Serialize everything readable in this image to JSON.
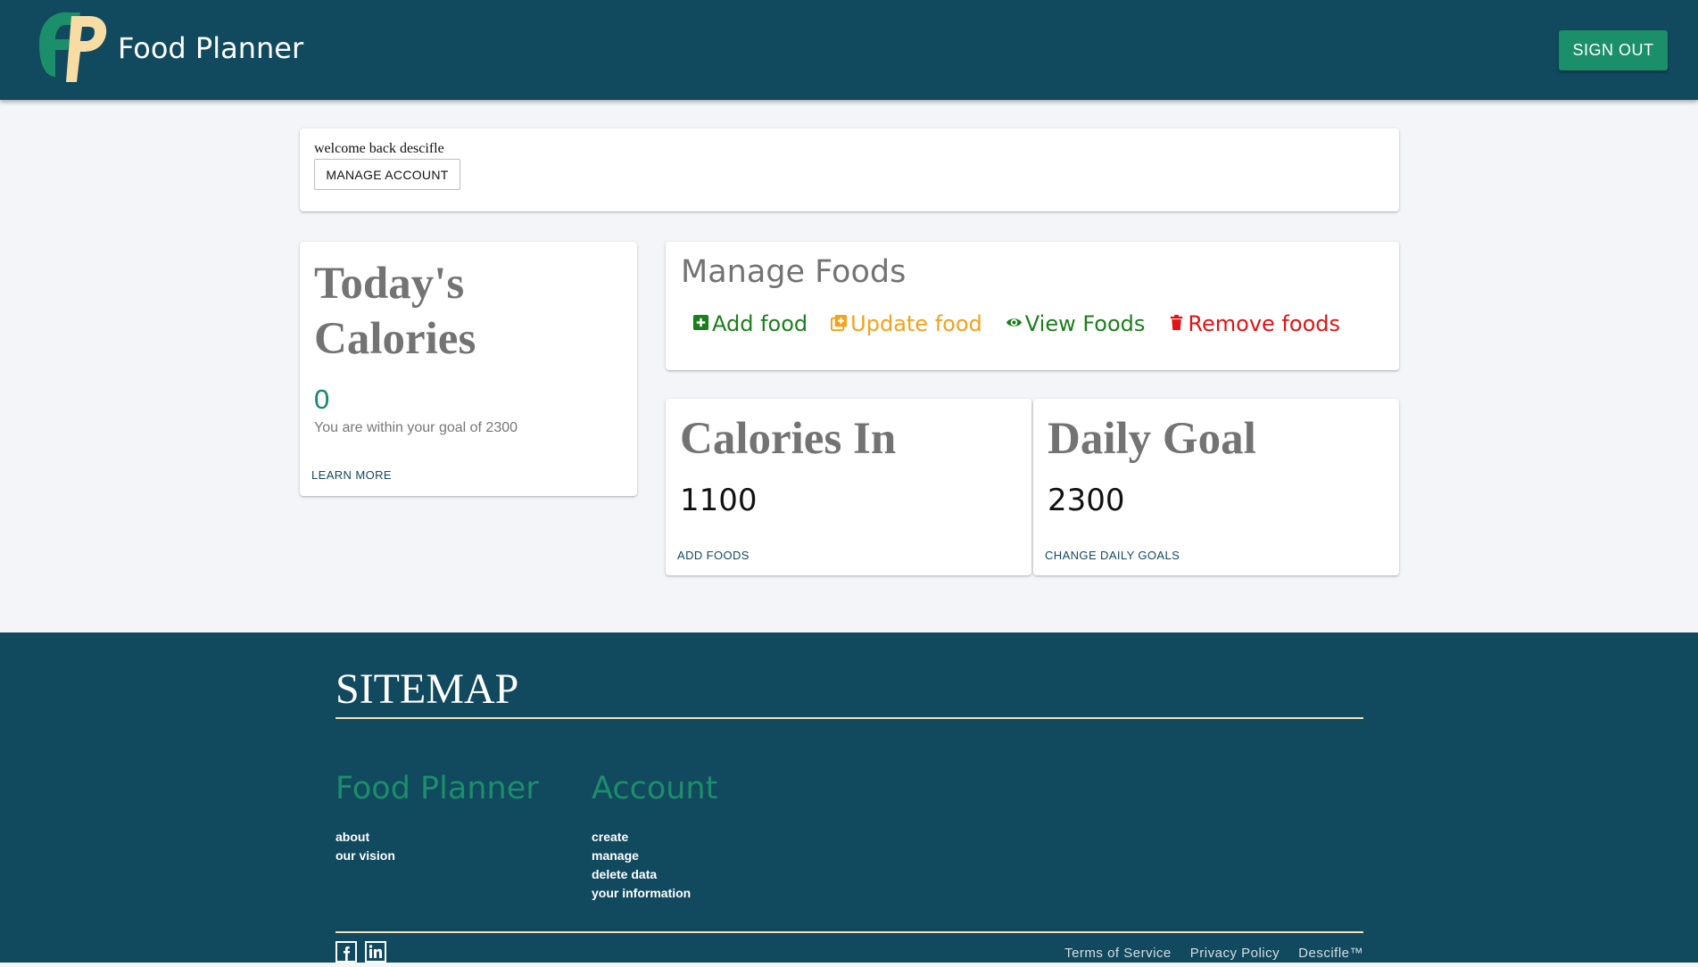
{
  "header": {
    "brand": "Food Planner",
    "sign_out_label": "SIGN OUT",
    "logo_icon": "fp-logo",
    "colors": {
      "bar": "#11495f",
      "accent": "#1b8e6a",
      "logo_cream": "#f7dca4"
    }
  },
  "welcome": {
    "text": "welcome back descifle",
    "manage_account_label": "MANAGE ACCOUNT"
  },
  "today": {
    "title": "Today's Calories",
    "value": "0",
    "subtitle": "You are within your goal of 2300",
    "link": "LEARN MORE"
  },
  "manage_foods": {
    "title": "Manage Foods",
    "actions": [
      {
        "label": "Add food",
        "icon": "plus-square-icon",
        "color": "#1a7f1a"
      },
      {
        "label": "Update food",
        "icon": "copy-plus-icon",
        "color": "#f2a21b"
      },
      {
        "label": "View Foods",
        "icon": "eye-icon",
        "color": "#1a7f1a"
      },
      {
        "label": "Remove foods",
        "icon": "trash-icon",
        "color": "#e31313"
      }
    ]
  },
  "calories_in": {
    "title": "Calories In",
    "value": "1100",
    "link": "ADD FOODS"
  },
  "daily_goal": {
    "title": "Daily Goal",
    "value": "2300",
    "link": "CHANGE DAILY GOALS"
  },
  "footer": {
    "sitemap_title": "SITEMAP",
    "columns": [
      {
        "title": "Food Planner",
        "links": [
          "about",
          "our vision"
        ]
      },
      {
        "title": "Account",
        "links": [
          "create",
          "manage",
          "delete data",
          "your information"
        ]
      }
    ],
    "social_icons": [
      "facebook-icon",
      "linkedin-icon"
    ],
    "legal_links": [
      "Terms of Service",
      "Privacy Policy",
      "Descifle™"
    ]
  }
}
